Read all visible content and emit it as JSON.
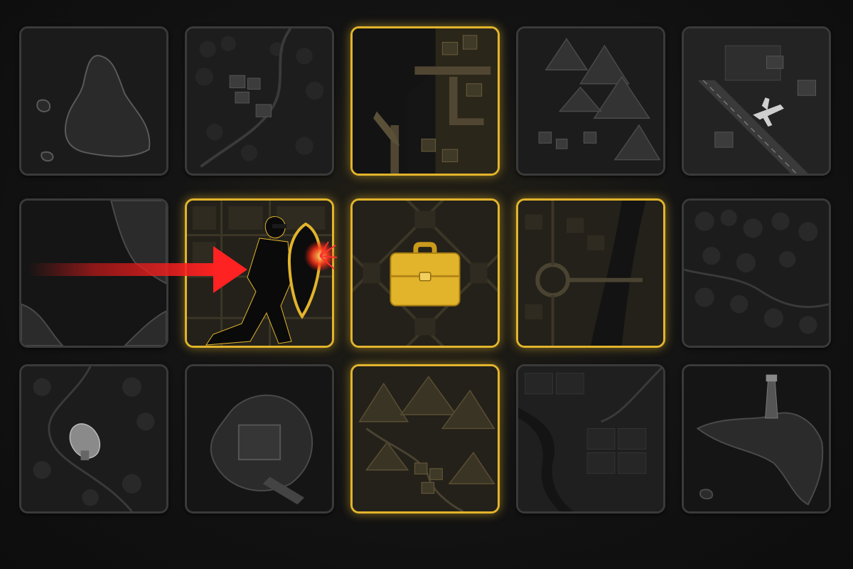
{
  "board": {
    "rows": 3,
    "cols": 5,
    "tiles": [
      {
        "id": "r1c1",
        "terrain": "island",
        "highlighted": false
      },
      {
        "id": "r1c2",
        "terrain": "forest-village",
        "highlighted": false
      },
      {
        "id": "r1c3",
        "terrain": "harbor",
        "highlighted": true
      },
      {
        "id": "r1c4",
        "terrain": "mountains",
        "highlighted": false
      },
      {
        "id": "r1c5",
        "terrain": "airfield",
        "highlighted": false
      },
      {
        "id": "r2c1",
        "terrain": "coastline",
        "highlighted": false
      },
      {
        "id": "r2c2",
        "terrain": "city-guarded",
        "highlighted": true
      },
      {
        "id": "r2c3",
        "terrain": "city-objective",
        "highlighted": true
      },
      {
        "id": "r2c4",
        "terrain": "city-river-bridge",
        "highlighted": true
      },
      {
        "id": "r2c5",
        "terrain": "forest",
        "highlighted": false
      },
      {
        "id": "r3c1",
        "terrain": "forest-radar",
        "highlighted": false
      },
      {
        "id": "r3c2",
        "terrain": "fortress-island",
        "highlighted": false
      },
      {
        "id": "r3c3",
        "terrain": "mountain-village",
        "highlighted": true
      },
      {
        "id": "r3c4",
        "terrain": "farmland-river",
        "highlighted": false
      },
      {
        "id": "r3c5",
        "terrain": "lighthouse-island",
        "highlighted": false
      }
    ]
  },
  "objective": {
    "icon": "briefcase-icon",
    "color": "#e2b42c"
  },
  "defender": {
    "icon": "shielded-agent-icon",
    "shield_color": "#e2b42c"
  },
  "attack": {
    "icon": "red-arrow-icon",
    "color": "#e01a1a"
  },
  "colors": {
    "highlight": "#e2b42c",
    "inactive_border": "#3a3a3a",
    "attack": "#e01a1a"
  }
}
